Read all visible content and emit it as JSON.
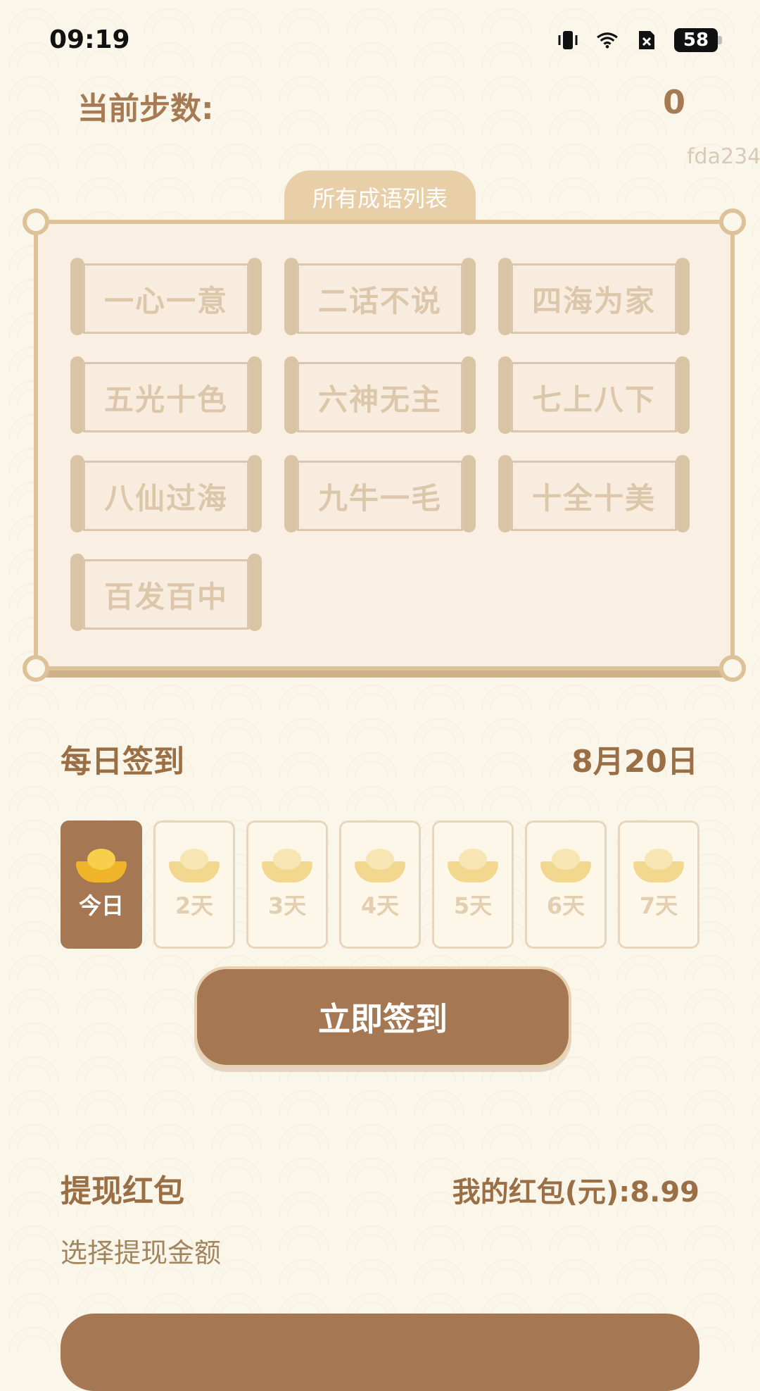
{
  "status_bar": {
    "time": "09:19",
    "battery": "58",
    "icons": [
      "vibrate-icon",
      "wifi-icon",
      "no-sim-icon",
      "battery-icon"
    ]
  },
  "steps": {
    "label": "当前步数:",
    "value": "0"
  },
  "watermark": "fda234",
  "idiom_panel": {
    "title": "所有成语列表",
    "items": [
      "一心一意",
      "二话不说",
      "四海为家",
      "五光十色",
      "六神无主",
      "七上八下",
      "八仙过海",
      "九牛一毛",
      "十全十美",
      "百发百中"
    ]
  },
  "checkin": {
    "title": "每日签到",
    "date": "8月20日",
    "days": [
      "今日",
      "2天",
      "3天",
      "4天",
      "5天",
      "6天",
      "7天"
    ],
    "button_label": "立即签到"
  },
  "withdraw": {
    "title": "提现红包",
    "my_redpacket": "我的红包(元):8.99",
    "choose_amount": "选择提现金额"
  },
  "colors": {
    "background": "#fbf6ea",
    "primary_brown": "#a57752",
    "accent_text": "#9a6f45",
    "panel_border": "#ddc298"
  }
}
